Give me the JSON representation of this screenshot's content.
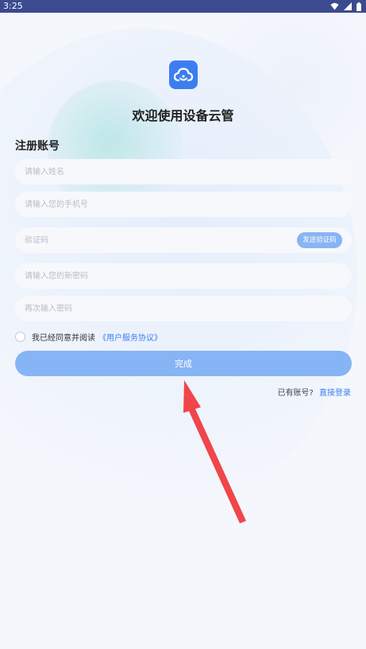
{
  "status_bar": {
    "time": "3:25"
  },
  "header": {
    "title": "欢迎使用设备云管",
    "logo_icon": "cloud-icon"
  },
  "form": {
    "section_title": "注册账号",
    "name_placeholder": "请输入姓名",
    "phone_placeholder": "请输入您的手机号",
    "code_placeholder": "验证码",
    "send_code_label": "发送验证码",
    "new_password_placeholder": "请输入您的新密码",
    "confirm_password_placeholder": "再次输入密码",
    "agree_text": "我已经同意并阅读",
    "agreement_link": "《用户服务协议》",
    "submit_label": "完成",
    "login_hint": "已有账号?",
    "login_link": "直接登录"
  },
  "colors": {
    "accent": "#3c7ef0",
    "button_fill": "#87b4f5",
    "annotation_arrow": "#f0454b"
  }
}
